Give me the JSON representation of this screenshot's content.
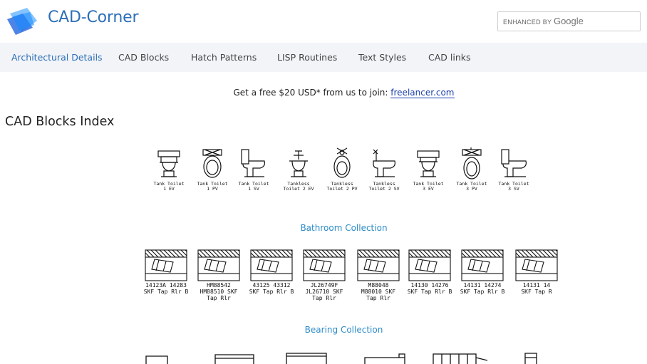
{
  "site": {
    "name": "CAD-Corner"
  },
  "search": {
    "enhanced_by": "ENHANCED BY",
    "provider": "Google"
  },
  "nav": {
    "items": [
      {
        "label": "Architectural Details",
        "active": true
      },
      {
        "label": "CAD Blocks",
        "active": false
      },
      {
        "label": "Hatch Patterns",
        "active": false
      },
      {
        "label": "LISP Routines",
        "active": false
      },
      {
        "label": "Text Styles",
        "active": false
      },
      {
        "label": "CAD links",
        "active": false
      }
    ]
  },
  "promo": {
    "text": "Get a free $20 USD* from us to join:",
    "link": "freelancer.com"
  },
  "page": {
    "title": "CAD Blocks Index"
  },
  "bathroom": {
    "collection_label": "Bathroom Collection",
    "items": [
      {
        "line1": "Tank Toilet",
        "line2": "1 EV"
      },
      {
        "line1": "Tank Toilet",
        "line2": "1 PV"
      },
      {
        "line1": "Tank Toilet",
        "line2": "1 SV"
      },
      {
        "line1": "Tankless",
        "line2": "Toilet 2 EV"
      },
      {
        "line1": "Tankless",
        "line2": "Toilet 2 PV"
      },
      {
        "line1": "Tankless",
        "line2": "Toilet 2 SV"
      },
      {
        "line1": "Tank Toilet",
        "line2": "3 EV"
      },
      {
        "line1": "Tank Toilet",
        "line2": "3 PV"
      },
      {
        "line1": "Tank Toilet",
        "line2": "3 SV"
      }
    ]
  },
  "bearing": {
    "collection_label": "Bearing Collection",
    "items": [
      {
        "line1": "14123A 14283",
        "line2": "SKF Tap Rlr B",
        "line3": ""
      },
      {
        "line1": "HM88542",
        "line2": "HM88510 SKF",
        "line3": "Tap Rlr"
      },
      {
        "line1": "43125 43312",
        "line2": "SKF Tap Rlr B",
        "line3": ""
      },
      {
        "line1": "JL26749F",
        "line2": "JL26710 SKF",
        "line3": "Tap Rlr"
      },
      {
        "line1": "M88048",
        "line2": "M88010 SKF",
        "line3": "Tap Rlr"
      },
      {
        "line1": "14130 14276",
        "line2": "SKF Tap Rlr B",
        "line3": ""
      },
      {
        "line1": "14131 14274",
        "line2": "SKF Tap Rlr B",
        "line3": ""
      },
      {
        "line1": "14131 14",
        "line2": "SKF Tap R",
        "line3": ""
      }
    ]
  },
  "colors": {
    "brand_blue": "#2d6fb8",
    "nav_background": "#f2f4f8",
    "collection_link": "#2d8cc8",
    "promo_link": "#1a3ea8"
  }
}
